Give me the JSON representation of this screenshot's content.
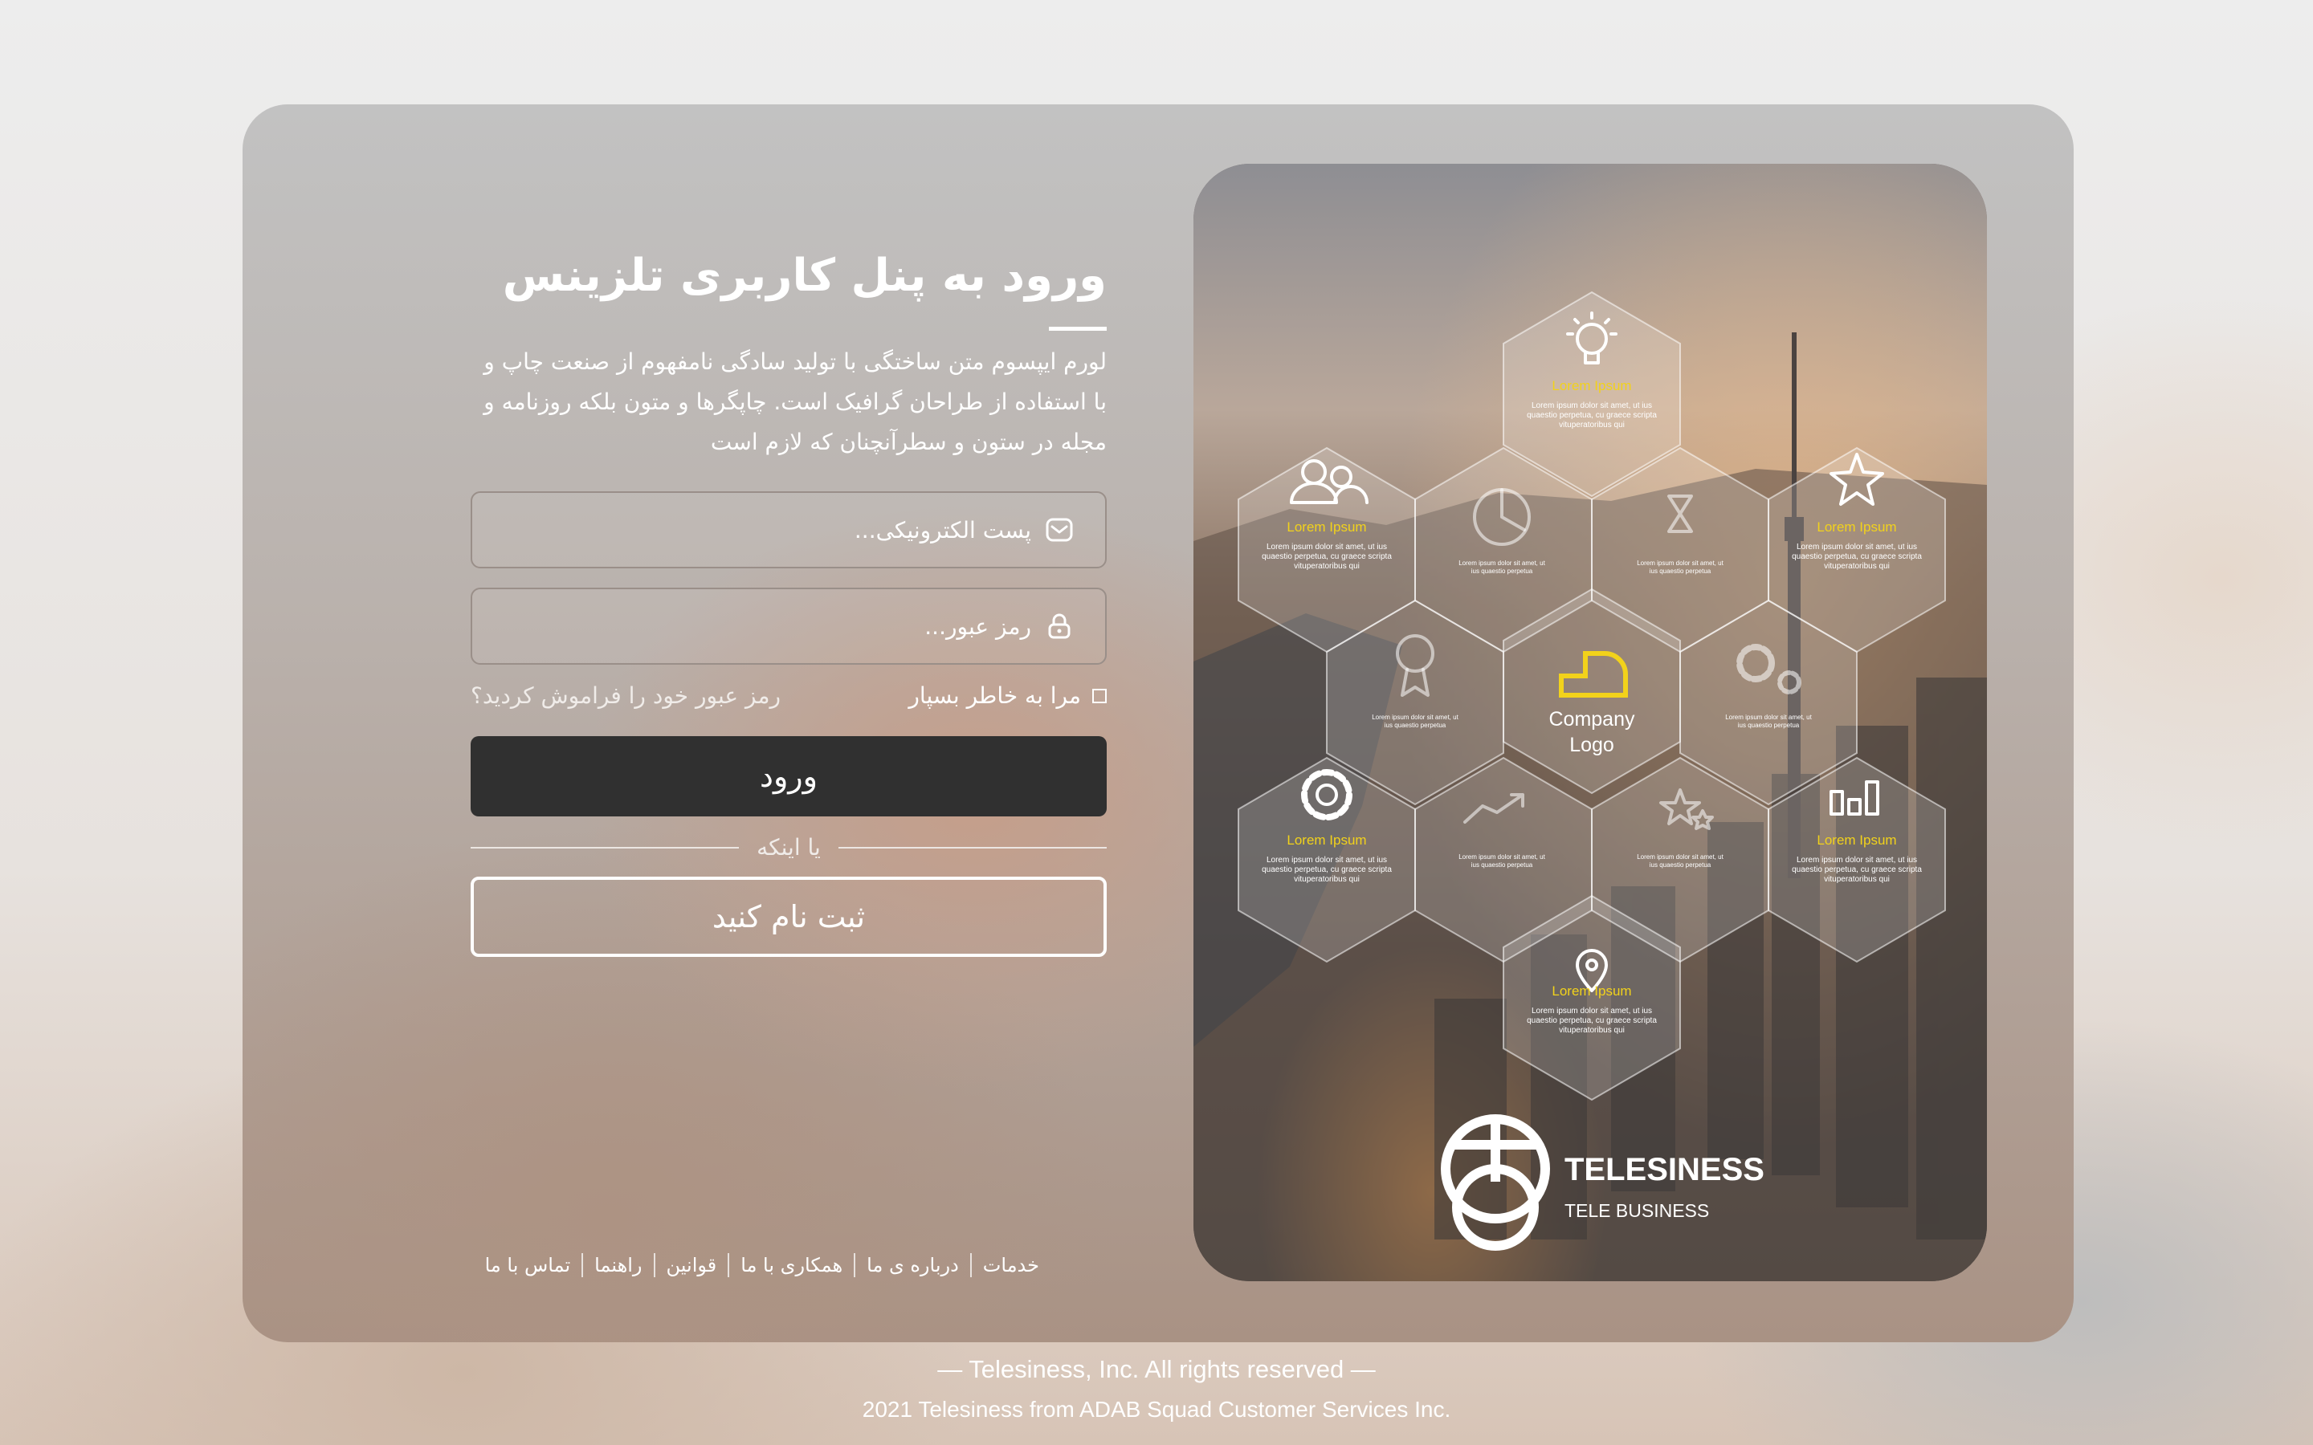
{
  "login": {
    "title": "ورود به پنل کاربری تلزینس",
    "description": "لورم ایپسوم متن ساختگی با تولید سادگی نامفهوم از صنعت چاپ و با استفاده از طراحان گرافیک است. چاپگرها و متون بلکه روزنامه و مجله در ستون و سطرآنچنان که لازم است",
    "email_placeholder": "پست الکترونیکی...",
    "password_placeholder": "رمز عبور...",
    "remember_label": "مرا به خاطر بسپار",
    "forgot_label": "رمز عبور خود را فراموش کردید؟",
    "login_button": "ورود",
    "divider_label": "یا اینکه",
    "register_button": "ثبت نام کنید"
  },
  "footer_nav": {
    "items": [
      "خدمات",
      "درباره ی ما",
      "همکاری با ما",
      "قوانین",
      "راهنما",
      "تماس با ما"
    ]
  },
  "promo": {
    "center_label_1": "Company",
    "center_label_2": "Logo",
    "hex_title": "Lorem Ipsum",
    "hex_text_1": "Lorem ipsum dolor sit amet, ut ius",
    "hex_text_2": "quaestio perpetua, cu graece scripta",
    "hex_text_3": "vituperatoribus qui",
    "small_text_1": "Lorem ipsum dolor sit amet, ut",
    "small_text_2": "ius quaestio perpetua",
    "brand_name": "TELESINESS",
    "brand_tagline": "TELE BUSINESS"
  },
  "copyright": {
    "line1": "— Telesiness, Inc. All rights reserved —",
    "line2": "2021 Telesiness from ADAB Squad Customer Services Inc."
  },
  "colors": {
    "accent_yellow": "#f2d21b",
    "button_dark": "#303030"
  }
}
